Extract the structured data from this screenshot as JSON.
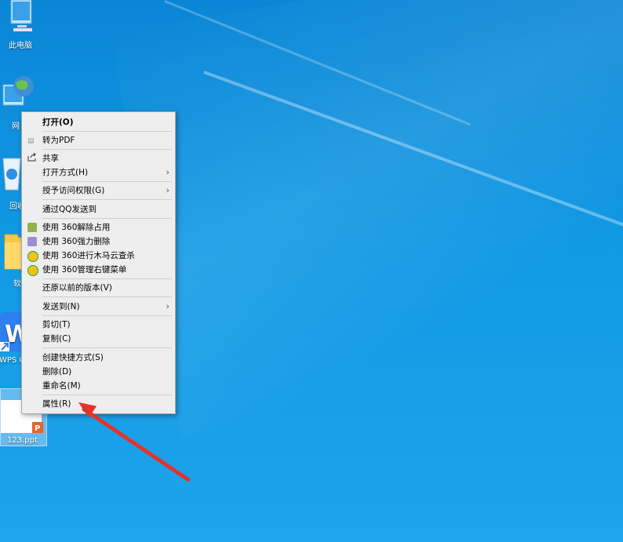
{
  "desktop": {
    "icons": [
      {
        "label": "此电脑"
      },
      {
        "label": "网"
      },
      {
        "label": "回收"
      },
      {
        "label": "软"
      },
      {
        "label": "WPS C"
      },
      {
        "label": "123.ppt"
      }
    ]
  },
  "context_menu": {
    "items": [
      {
        "label": "打开(O)"
      },
      {
        "label": "转为PDF"
      },
      {
        "label": "共享"
      },
      {
        "label": "打开方式(H)"
      },
      {
        "label": "授予访问权限(G)"
      },
      {
        "label": "通过QQ发送到"
      },
      {
        "label": "使用 360解除占用"
      },
      {
        "label": "使用 360强力删除"
      },
      {
        "label": "使用 360进行木马云查杀"
      },
      {
        "label": "使用 360管理右键菜单"
      },
      {
        "label": "还原以前的版本(V)"
      },
      {
        "label": "发送到(N)"
      },
      {
        "label": "剪切(T)"
      },
      {
        "label": "复制(C)"
      },
      {
        "label": "创建快捷方式(S)"
      },
      {
        "label": "删除(D)"
      },
      {
        "label": "重命名(M)"
      },
      {
        "label": "属性(R)"
      }
    ],
    "submenu_arrow": "›"
  },
  "colors": {
    "annotation_arrow": "#e5332a",
    "desktop_blue": "#1199e4"
  }
}
